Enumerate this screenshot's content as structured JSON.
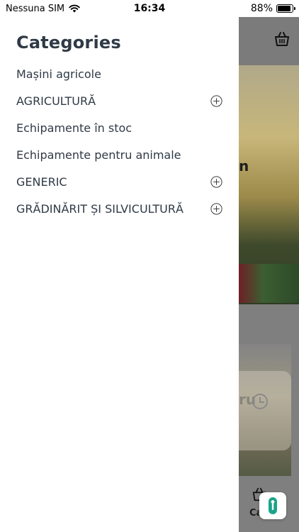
{
  "status_bar": {
    "carrier": "Nessuna SIM",
    "time": "16:34",
    "battery_percent": "88%",
    "battery_level": 0.88,
    "icons": [
      "wifi-icon",
      "battery-icon"
    ]
  },
  "drawer": {
    "title": "Categories",
    "items": [
      {
        "label": "Mașini agricole",
        "expandable": false
      },
      {
        "label": "AGRICULTURĂ",
        "expandable": true
      },
      {
        "label": "Echipamente în stoc",
        "expandable": false
      },
      {
        "label": "Echipamente pentru animale",
        "expandable": false
      },
      {
        "label": "GENERIC",
        "expandable": true
      },
      {
        "label": "GRĂDINĂRIT ȘI SILVICULTURĂ",
        "expandable": true
      }
    ],
    "expand_icon": "plus-circle-icon"
  },
  "background": {
    "banner_partial_text": "n",
    "card_partial_text": "ru",
    "bottom_tab_partial_label": "Ca",
    "icons": [
      "cart-icon",
      "clock-icon",
      "cart-icon"
    ]
  },
  "floating": {
    "icon": "key-icon",
    "accent": "#1aa48a"
  },
  "colors": {
    "drawer_text": "#2f3a46",
    "overlay_dim": "#7f7f7f"
  }
}
